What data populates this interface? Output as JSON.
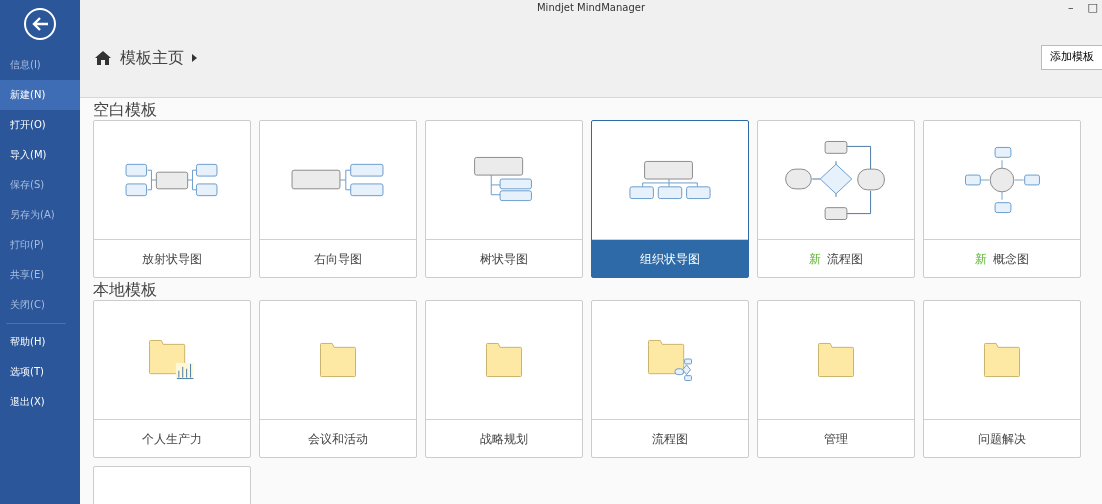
{
  "window": {
    "title": "Mindjet MindManager",
    "controls": [
      "–",
      "□"
    ]
  },
  "sidebar": {
    "groups": [
      [
        {
          "label": "信息(I)",
          "selected": false,
          "disabled": true
        },
        {
          "label": "新建(N)",
          "selected": true,
          "disabled": false
        },
        {
          "label": "打开(O)",
          "selected": false,
          "disabled": false
        },
        {
          "label": "导入(M)",
          "selected": false,
          "disabled": false
        },
        {
          "label": "保存(S)",
          "selected": false,
          "disabled": true
        },
        {
          "label": "另存为(A)",
          "selected": false,
          "disabled": true
        },
        {
          "label": "打印(P)",
          "selected": false,
          "disabled": true
        },
        {
          "label": "共享(E)",
          "selected": false,
          "disabled": true
        },
        {
          "label": "关闭(C)",
          "selected": false,
          "disabled": true
        }
      ],
      [
        {
          "label": "帮助(H)",
          "selected": false,
          "disabled": false
        },
        {
          "label": "选项(T)",
          "selected": false,
          "disabled": false
        },
        {
          "label": "退出(X)",
          "selected": false,
          "disabled": false
        }
      ]
    ]
  },
  "breadcrumb": {
    "label": "模板主页"
  },
  "add_template_button": "添加模板",
  "sections": [
    {
      "title": "空白模板",
      "cards": [
        {
          "kind": "radial",
          "label": "放射状导图",
          "selected": false
        },
        {
          "kind": "right",
          "label": "右向导图",
          "selected": false
        },
        {
          "kind": "tree",
          "label": "树状导图",
          "selected": false
        },
        {
          "kind": "org",
          "label": "组织状导图",
          "selected": true
        },
        {
          "kind": "flowchart",
          "badge": "新",
          "label": "流程图",
          "selected": false
        },
        {
          "kind": "concept",
          "badge": "新",
          "label": "概念图",
          "selected": false
        }
      ]
    },
    {
      "title": "本地模板",
      "cards": [
        {
          "kind": "folder-chart",
          "label": "个人生产力",
          "selected": false
        },
        {
          "kind": "folder",
          "label": "会议和活动",
          "selected": false
        },
        {
          "kind": "folder",
          "label": "战略规划",
          "selected": false
        },
        {
          "kind": "folder-flow",
          "label": "流程图",
          "selected": false
        },
        {
          "kind": "folder",
          "label": "管理",
          "selected": false
        },
        {
          "kind": "folder",
          "label": "问题解决",
          "selected": false
        },
        {
          "kind": "blank",
          "selected": false
        }
      ]
    }
  ]
}
